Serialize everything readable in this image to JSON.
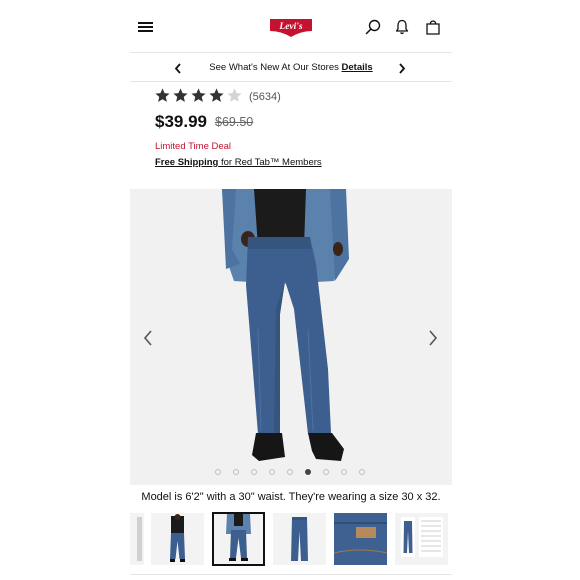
{
  "header": {
    "logo_text": "Levi's",
    "icons": [
      "menu-icon",
      "search-icon",
      "bell-icon",
      "shopping-bag-icon"
    ]
  },
  "promo": {
    "text": "See What's New At Our Stores ",
    "link": "Details"
  },
  "product": {
    "rating": 4,
    "review_count": "(5634)",
    "price": "$39.99",
    "original_price": "$69.50",
    "deal_label": "Limited Time Deal",
    "shipping_link": "Free Shipping",
    "shipping_text": " for Red Tab™ Members"
  },
  "carousel": {
    "total_images": 9,
    "active_index": 5,
    "caption": "Model is 6'2\" with a 30\" waist. They're wearing a size 30 x 32."
  },
  "colors": {
    "accent_red": "#c41230",
    "denim": "#3d5f8f"
  }
}
